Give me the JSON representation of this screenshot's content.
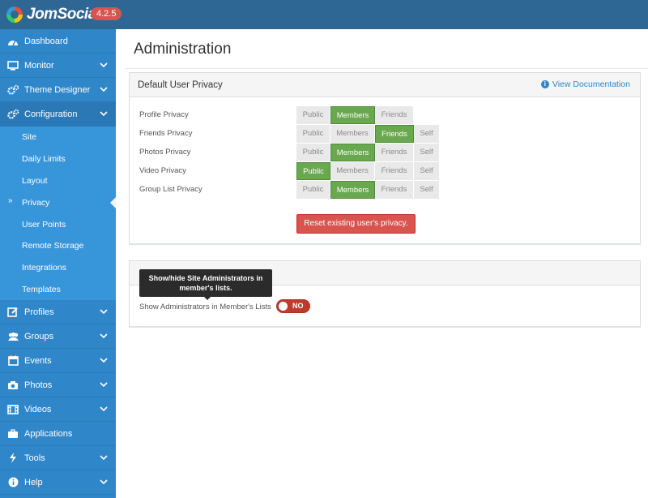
{
  "app": {
    "name": "JomSocial",
    "version": "4.2.5"
  },
  "sidebar": {
    "items": [
      {
        "label": "Dashboard",
        "icon": "dashboard-icon",
        "expandable": false
      },
      {
        "label": "Monitor",
        "icon": "monitor-icon",
        "expandable": true
      },
      {
        "label": "Theme Designer",
        "icon": "cogs-icon",
        "expandable": true
      },
      {
        "label": "Configuration",
        "icon": "cogs-icon",
        "expandable": true,
        "expanded": true
      },
      {
        "label": "Profiles",
        "icon": "edit-icon",
        "expandable": true
      },
      {
        "label": "Groups",
        "icon": "users-icon",
        "expandable": true
      },
      {
        "label": "Events",
        "icon": "calendar-icon",
        "expandable": true
      },
      {
        "label": "Photos",
        "icon": "camera-icon",
        "expandable": true
      },
      {
        "label": "Videos",
        "icon": "film-icon",
        "expandable": true
      },
      {
        "label": "Applications",
        "icon": "briefcase-icon",
        "expandable": false
      },
      {
        "label": "Tools",
        "icon": "bolt-icon",
        "expandable": true
      },
      {
        "label": "Help",
        "icon": "info-icon",
        "expandable": true
      }
    ],
    "configuration_sub": [
      "Site",
      "Daily Limits",
      "Layout",
      "Privacy",
      "User Points",
      "Remote Storage",
      "Integrations",
      "Templates"
    ],
    "current_sub": "Privacy"
  },
  "main": {
    "title": "Administration",
    "privacy_panel": {
      "heading": "Default User Privacy",
      "doc_link": "View Documentation",
      "options": {
        "public": "Public",
        "members": "Members",
        "friends": "Friends",
        "self": "Self"
      },
      "rows": [
        {
          "label": "Profile Privacy",
          "selected": "Members"
        },
        {
          "label": "Friends Privacy",
          "selected": "Friends"
        },
        {
          "label": "Photos Privacy",
          "selected": "Members"
        },
        {
          "label": "Video Privacy",
          "selected": "Public"
        },
        {
          "label": "Group List Privacy",
          "selected": "Members"
        }
      ],
      "reset_button": "Reset existing user's privacy."
    },
    "admin_panel": {
      "toggle_label": "Show Administrators in Member's Lists",
      "toggle_value": "NO",
      "tooltip": "Show/hide Site Administrators in member's lists."
    }
  },
  "colors": {
    "topbar": "#2e6694",
    "sidebar": "#2f86c9",
    "selected": "#6aa84f",
    "danger": "#d9534f"
  }
}
